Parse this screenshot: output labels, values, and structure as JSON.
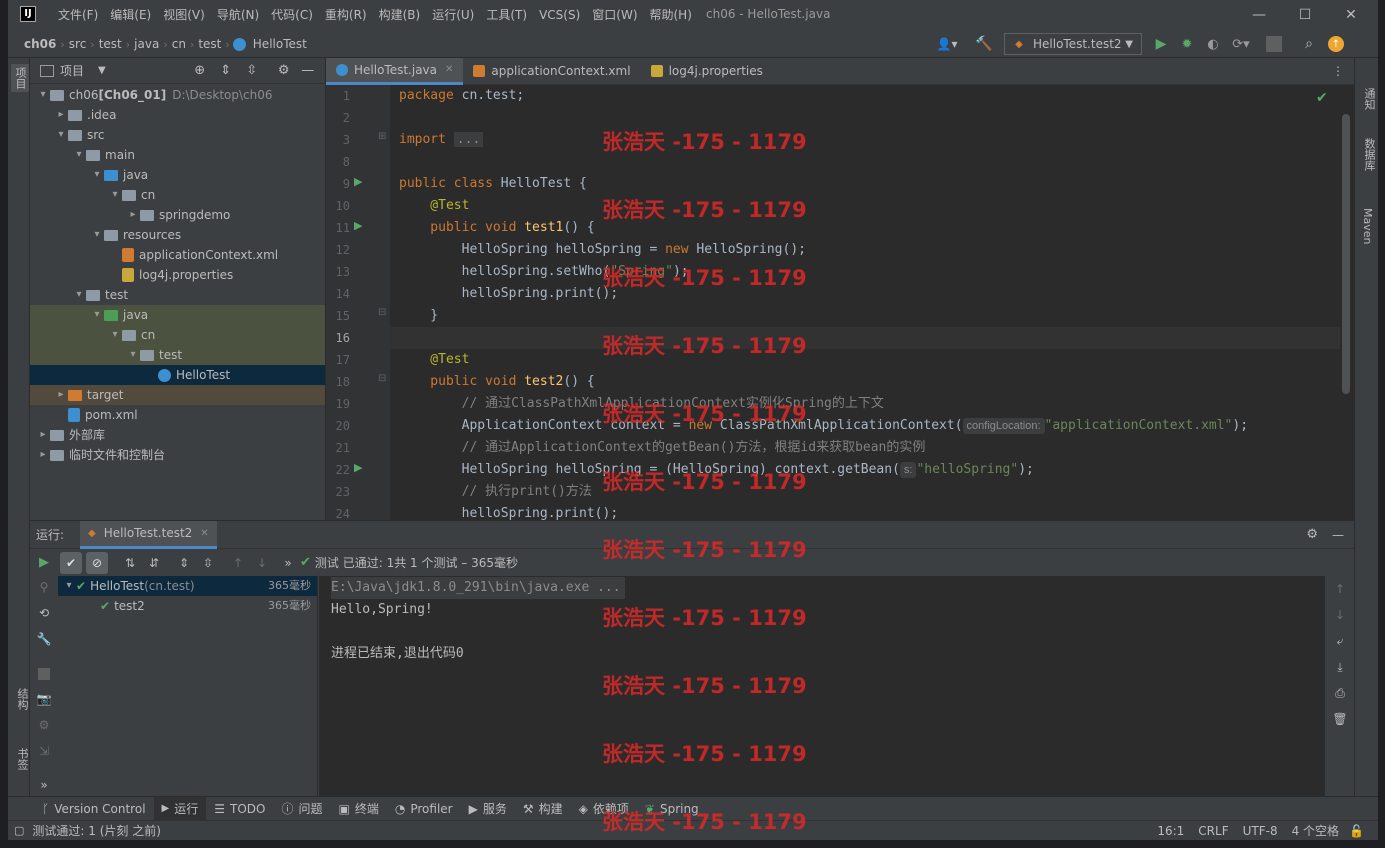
{
  "window": {
    "title": "ch06 - HelloTest.java",
    "logo": "IJ"
  },
  "menu": [
    "文件(F)",
    "编辑(E)",
    "视图(V)",
    "导航(N)",
    "代码(C)",
    "重构(R)",
    "构建(B)",
    "运行(U)",
    "工具(T)",
    "VCS(S)",
    "窗口(W)",
    "帮助(H)"
  ],
  "breadcrumb": [
    "ch06",
    "src",
    "test",
    "java",
    "cn",
    "test",
    "HelloTest"
  ],
  "run_config": "HelloTest.test2",
  "left_strip": {
    "project": "项目",
    "structure": "结构",
    "bookmarks": "书签"
  },
  "right_strip": {
    "notifications": "通知",
    "database": "数据库",
    "maven": "Maven"
  },
  "project_panel": {
    "title": "项目",
    "tree": [
      {
        "label": "ch06",
        "bold_suffix": " [Ch06_01]",
        "path": "D:\\Desktop\\ch06",
        "depth": 0,
        "arrow": "▾",
        "icon": "folder"
      },
      {
        "label": ".idea",
        "depth": 1,
        "arrow": "▸",
        "icon": "folder"
      },
      {
        "label": "src",
        "depth": 1,
        "arrow": "▾",
        "icon": "folder"
      },
      {
        "label": "main",
        "depth": 2,
        "arrow": "▾",
        "icon": "folder"
      },
      {
        "label": "java",
        "depth": 3,
        "arrow": "▾",
        "icon": "folder-blue"
      },
      {
        "label": "cn",
        "depth": 4,
        "arrow": "▾",
        "icon": "package"
      },
      {
        "label": "springdemo",
        "depth": 5,
        "arrow": "▸",
        "icon": "package"
      },
      {
        "label": "resources",
        "depth": 3,
        "arrow": "▾",
        "icon": "folder-resources"
      },
      {
        "label": "applicationContext.xml",
        "depth": 4,
        "arrow": "",
        "icon": "xml-file"
      },
      {
        "label": "log4j.properties",
        "depth": 4,
        "arrow": "",
        "icon": "properties-file"
      },
      {
        "label": "test",
        "depth": 2,
        "arrow": "▾",
        "icon": "folder"
      },
      {
        "label": "java",
        "depth": 3,
        "arrow": "▾",
        "icon": "folder-green"
      },
      {
        "label": "cn",
        "depth": 4,
        "arrow": "▾",
        "icon": "package"
      },
      {
        "label": "test",
        "depth": 5,
        "arrow": "▾",
        "icon": "package"
      },
      {
        "label": "HelloTest",
        "depth": 6,
        "arrow": "",
        "icon": "class-file"
      },
      {
        "label": "target",
        "depth": 1,
        "arrow": "▸",
        "icon": "folder-orange"
      },
      {
        "label": "pom.xml",
        "depth": 1,
        "arrow": "",
        "icon": "maven-file"
      },
      {
        "label": "外部库",
        "depth": 0,
        "arrow": "▸",
        "icon": "library"
      },
      {
        "label": "临时文件和控制台",
        "depth": 0,
        "arrow": "▸",
        "icon": "scratch"
      }
    ]
  },
  "editor": {
    "tabs": [
      {
        "label": "HelloTest.java",
        "active": true
      },
      {
        "label": "applicationContext.xml",
        "active": false
      },
      {
        "label": "log4j.properties",
        "active": false
      }
    ],
    "line_numbers": [
      "1",
      "2",
      "3",
      "8",
      "9",
      "10",
      "11",
      "12",
      "13",
      "14",
      "15",
      "16",
      "17",
      "18",
      "19",
      "20",
      "21",
      "22",
      "23",
      "24"
    ],
    "code": {
      "l1a": "package",
      "l1b": " cn.test;",
      "l3a": "import",
      "l3b": "...",
      "l9a": "public class",
      "l9b": " HelloTest {",
      "l10": "    @Test",
      "l11a": "    public void",
      "l11b": " test1",
      "l11c": "() {",
      "l12a": "        HelloSpring helloSpring = ",
      "l12b": "new",
      "l12c": " HelloSpring();",
      "l13a": "        helloSpring.setWho(",
      "l13b": "\"Spring\"",
      "l13c": ");",
      "l14": "        helloSpring.print();",
      "l15": "    }",
      "l17": "    @Test",
      "l18a": "    public void",
      "l18b": " test2",
      "l18c": "() {",
      "l19": "        // 通过ClassPathXmlApplicationContext实例化Spring的上下文",
      "l20a": "        ApplicationContext context = ",
      "l20b": "new",
      "l20c": " ClassPathXmlApplicationContext(",
      "l20hint": "configLocation:",
      "l20d": "\"applicationContext.xml\"",
      "l20e": ");",
      "l21": "        // 通过ApplicationContext的getBean()方法，根据id来获取bean的实例",
      "l22a": "        HelloSpring helloSpring = (HelloSpring) context.getBean(",
      "l22hint": "s:",
      "l22b": "\"helloSpring\"",
      "l22c": ");",
      "l23": "        // 执行print()方法",
      "l24": "        helloSpring.print();"
    }
  },
  "run_panel": {
    "label": "运行:",
    "tab": "HelloTest.test2",
    "status": "测试 已通过: 1共 1 个测试 – 365毫秒",
    "tree": [
      {
        "label": "HelloTest",
        "suffix": " (cn.test)",
        "time": "365毫秒"
      },
      {
        "label": "test2",
        "suffix": "",
        "time": "365毫秒"
      }
    ],
    "console": [
      "E:\\Java\\jdk1.8.0_291\\bin\\java.exe ...",
      "Hello,Spring!",
      "",
      "进程已结束,退出代码0"
    ]
  },
  "bottom_tabs": [
    "Version Control",
    "运行",
    "TODO",
    "问题",
    "终端",
    "Profiler",
    "服务",
    "构建",
    "依赖项",
    "Spring"
  ],
  "status_bar": {
    "message": "测试通过: 1 (片刻 之前)",
    "position": "16:1",
    "line_sep": "CRLF",
    "encoding": "UTF-8",
    "indent": "4 个空格"
  },
  "watermark": "张浩天 -175 - 1179",
  "colors": {
    "accent": "#4a88c7",
    "keyword": "#cc7832",
    "annotation": "#bbb529",
    "string": "#6a8759",
    "comment": "#808080",
    "success": "#59a869"
  }
}
